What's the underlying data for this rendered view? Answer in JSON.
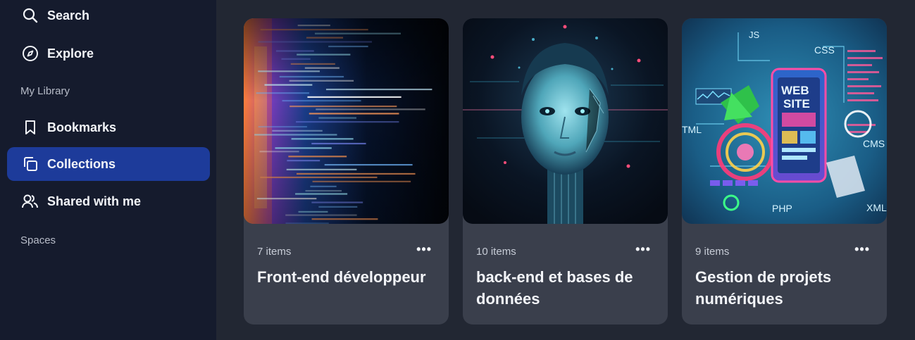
{
  "sidebar": {
    "search_label": "Search",
    "explore_label": "Explore",
    "my_library_label": "My Library",
    "bookmarks_label": "Bookmarks",
    "collections_label": "Collections",
    "shared_label": "Shared with me",
    "spaces_label": "Spaces",
    "active_item": "Collections",
    "accent_color": "#1d3b9a"
  },
  "collections": [
    {
      "count": "7 items",
      "title": "Front-end développeur",
      "image": "code-screen-image",
      "more_label": "•••"
    },
    {
      "count": "10 items",
      "title": "back-end et bases de données",
      "image": "ai-face-image",
      "more_label": "•••"
    },
    {
      "count": "9 items",
      "title": "Gestion de projets numériques",
      "image": "website-phone-image",
      "more_label": "•••"
    }
  ],
  "images": {
    "card3": {
      "js": "JS",
      "css": "CSS",
      "web": "WEB",
      "site": "SITE",
      "html": "TML",
      "cms": "CMS",
      "php": "PHP",
      "xml": "XML"
    }
  }
}
